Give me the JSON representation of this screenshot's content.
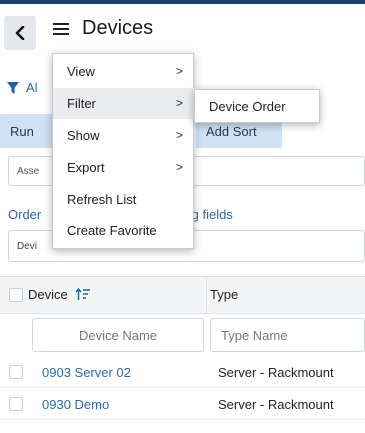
{
  "header": {
    "title": "Devices",
    "back_icon": "chevron-left-icon",
    "menu_icon": "hamburger-icon"
  },
  "filter_bar": {
    "icon": "funnel-icon",
    "label": "Al"
  },
  "buttons": {
    "run_label": "Run",
    "add_sort_label": "Add Sort"
  },
  "asset_field": {
    "value": "Asse"
  },
  "order_link": {
    "prefix": "Order",
    "suffix": "ving fields"
  },
  "device_field": {
    "value": "Devi"
  },
  "menu": {
    "items": [
      {
        "label": "View",
        "has_submenu": true
      },
      {
        "label": "Filter",
        "has_submenu": true,
        "highlighted": true
      },
      {
        "label": "Show",
        "has_submenu": true
      },
      {
        "label": "Export",
        "has_submenu": true
      },
      {
        "label": "Refresh List",
        "has_submenu": false
      },
      {
        "label": "Create Favorite",
        "has_submenu": false
      }
    ],
    "arrow": ">"
  },
  "submenu": {
    "items": [
      {
        "label": "Device Order"
      }
    ]
  },
  "table": {
    "columns": [
      {
        "header": "Device",
        "filter_placeholder": "Device Name",
        "sort_icon": "sort-ascending-icon"
      },
      {
        "header": "Type",
        "filter_placeholder": "Type Name"
      }
    ],
    "rows": [
      {
        "device": "0903 Server 02",
        "type": "Server - Rackmount"
      },
      {
        "device": "0930 Demo",
        "type": "Server - Rackmount"
      }
    ]
  },
  "colors": {
    "accent_link": "#2a68b3",
    "button_bg": "#cfe2f3",
    "top_bar": "#1b3d6e",
    "menu_highlight": "#e8eaed"
  }
}
